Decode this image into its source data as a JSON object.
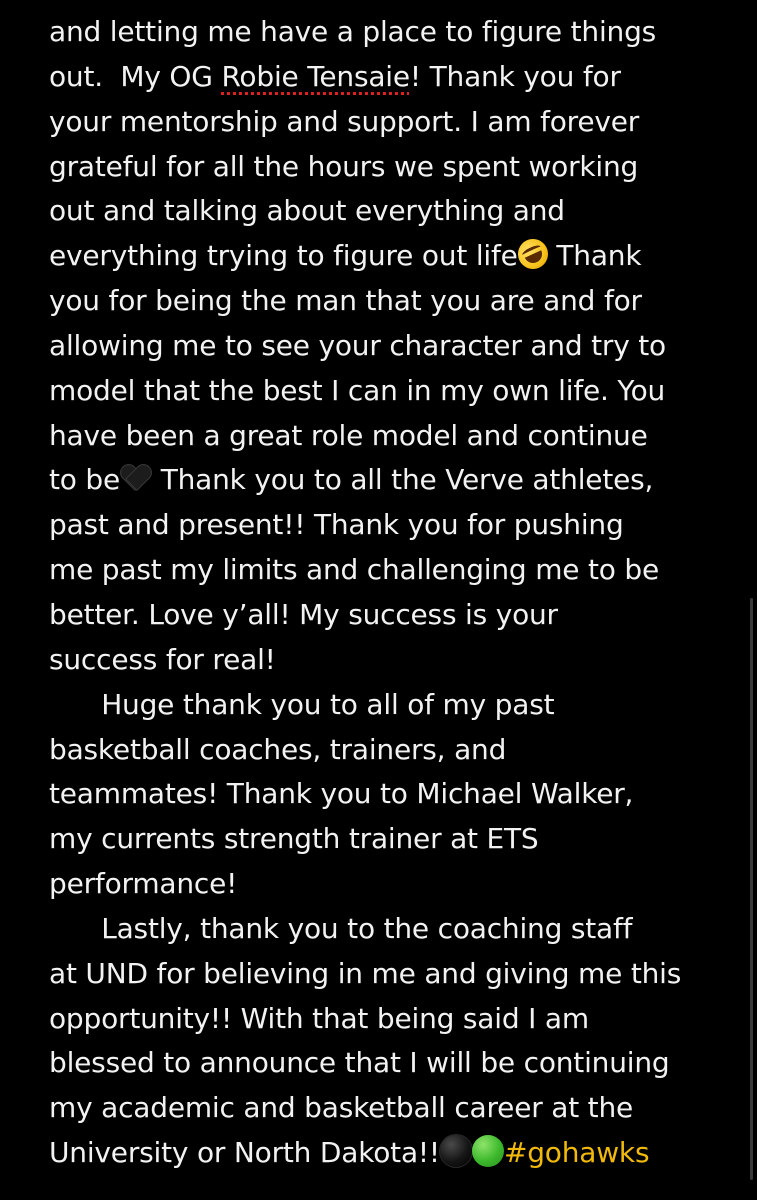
{
  "note": {
    "lines": [
      {
        "segments": [
          {
            "type": "text",
            "text": "and letting me have a place to figure things"
          }
        ]
      },
      {
        "segments": [
          {
            "type": "text",
            "text": "out.  My OG "
          },
          {
            "type": "misspelled",
            "text": "Robie Tensaie"
          },
          {
            "type": "text",
            "text": "! Thank you for"
          }
        ]
      },
      {
        "segments": [
          {
            "type": "text",
            "text": "your mentorship and support. I am forever"
          }
        ]
      },
      {
        "segments": [
          {
            "type": "text",
            "text": "grateful for all the hours we spent working"
          }
        ]
      },
      {
        "segments": [
          {
            "type": "text",
            "text": "out and talking about everything and"
          }
        ]
      },
      {
        "segments": [
          {
            "type": "text",
            "text": "everything trying to figure out life"
          },
          {
            "type": "emoji",
            "icon": "rofl-emoji-icon"
          },
          {
            "type": "text",
            "text": " Thank"
          }
        ]
      },
      {
        "segments": [
          {
            "type": "text",
            "text": "you for being the man that you are and for"
          }
        ]
      },
      {
        "segments": [
          {
            "type": "text",
            "text": "allowing me to see your character and try to"
          }
        ]
      },
      {
        "segments": [
          {
            "type": "text",
            "text": "model that the best I can in my own life. You"
          }
        ]
      },
      {
        "segments": [
          {
            "type": "text",
            "text": "have been a great role model and continue"
          }
        ]
      },
      {
        "segments": [
          {
            "type": "text",
            "text": "to be"
          },
          {
            "type": "emoji",
            "icon": "black-heart-icon"
          },
          {
            "type": "text",
            "text": " Thank you to all the Verve athletes,"
          }
        ]
      },
      {
        "segments": [
          {
            "type": "text",
            "text": "past and present!! Thank you for pushing"
          }
        ]
      },
      {
        "segments": [
          {
            "type": "text",
            "text": "me past my limits and challenging me to be"
          }
        ]
      },
      {
        "segments": [
          {
            "type": "text",
            "text": "better. Love y’all! My success is your"
          }
        ]
      },
      {
        "segments": [
          {
            "type": "text",
            "text": "success for real!"
          }
        ]
      },
      {
        "segments": [
          {
            "type": "text",
            "text": "      Huge thank you to all of my past"
          }
        ]
      },
      {
        "segments": [
          {
            "type": "text",
            "text": "basketball coaches, trainers, and"
          }
        ]
      },
      {
        "segments": [
          {
            "type": "text",
            "text": "teammates! Thank you to Michael Walker,"
          }
        ]
      },
      {
        "segments": [
          {
            "type": "text",
            "text": "my currents strength trainer at ETS"
          }
        ]
      },
      {
        "segments": [
          {
            "type": "text",
            "text": "performance!"
          }
        ]
      },
      {
        "segments": [
          {
            "type": "text",
            "text": "      Lastly, thank you to the coaching staff"
          }
        ]
      },
      {
        "segments": [
          {
            "type": "text",
            "text": "at UND for believing in me and giving me this"
          }
        ]
      },
      {
        "segments": [
          {
            "type": "text",
            "text": "opportunity!! With that being said I am"
          }
        ]
      },
      {
        "segments": [
          {
            "type": "text",
            "text": "blessed to announce that I will be continuing"
          }
        ]
      },
      {
        "segments": [
          {
            "type": "text",
            "text": "my academic and basketball career at the"
          }
        ]
      },
      {
        "segments": [
          {
            "type": "text",
            "text": "University or North Dakota!!"
          },
          {
            "type": "emoji",
            "icon": "black-circle-icon"
          },
          {
            "type": "emoji",
            "icon": "green-circle-icon"
          },
          {
            "type": "hashtag",
            "text": "#gohawks"
          }
        ]
      }
    ]
  },
  "colors": {
    "background": "#000000",
    "text": "#f2f2f2",
    "hashtag": "#f0b90b",
    "spellcheck_underline": "#e02020"
  }
}
